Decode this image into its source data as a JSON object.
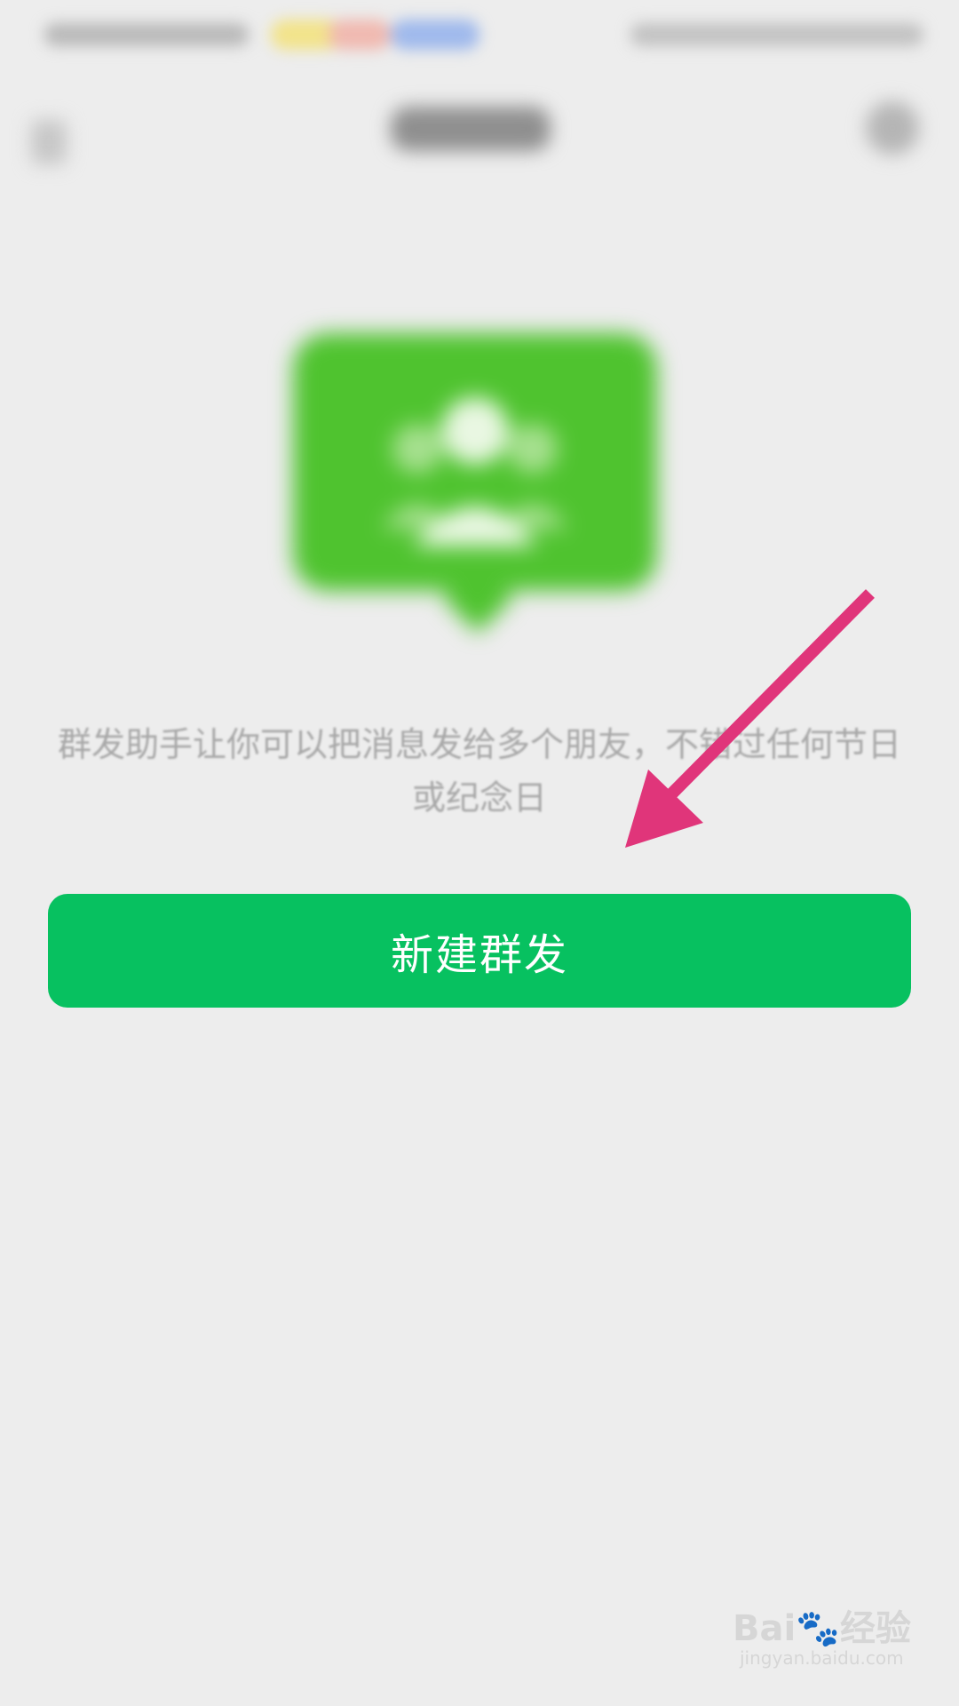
{
  "status_bar": {
    "icons": [
      "signal-icon",
      "wifi-icon",
      "battery-icon"
    ]
  },
  "nav": {
    "back_icon": "back-arrow-icon",
    "more_icon": "more-icon"
  },
  "hero": {
    "icon": "group-broadcast-icon",
    "color": "#4fc32f"
  },
  "description": {
    "line1": "群发助手让你可以把消息发给多个朋友，不错过任何节日",
    "line2": "或纪念日"
  },
  "primary_button": {
    "label": "新建群发",
    "color": "#07c160"
  },
  "annotation": {
    "arrow_color": "#e0357a"
  },
  "watermark": {
    "logo": "Bai🐾经验",
    "url": "jingyan.baidu.com"
  }
}
